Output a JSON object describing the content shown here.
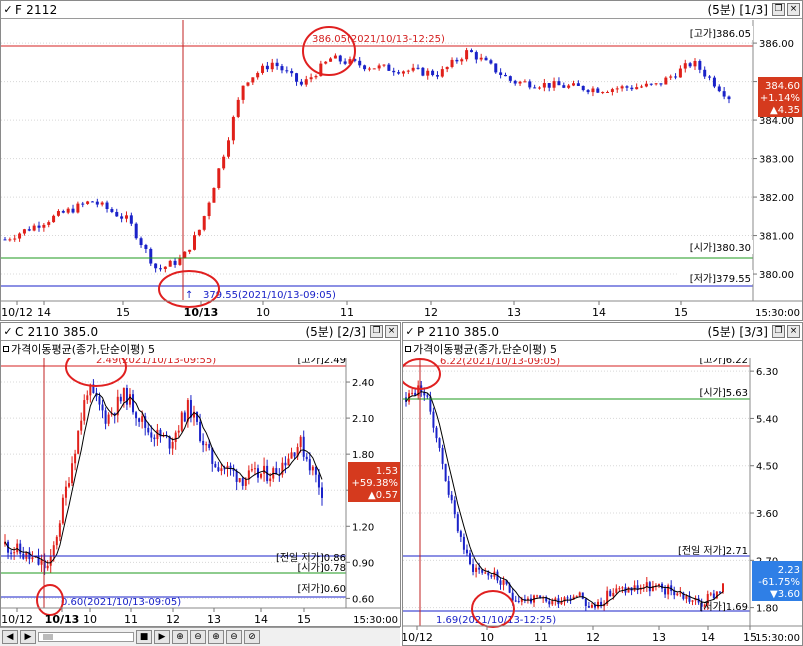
{
  "colors": {
    "up": "#e0201a",
    "down": "#1a22c8",
    "high_line": "#d42020",
    "open_line": "#1e9a1e",
    "low_line": "#1a22c8",
    "ma": "#000000",
    "circle": "#e02020"
  },
  "icons": {
    "check": "✓",
    "maximize": "□",
    "restore": "❐",
    "close": "×"
  },
  "scroll_icons": [
    "◀",
    "▶",
    "■",
    "▶",
    "⊕",
    "⊖",
    "⊕",
    "⊖",
    "⊘"
  ],
  "top": {
    "title": "F 2112",
    "period": "(5분)",
    "page": "[1/3]",
    "high_label": "[고가]386.05",
    "open_label": "[시가]380.30",
    "low_label": "[저가]379.55",
    "high_annotation": "386.05(2021/10/13-12:25)",
    "low_annotation": "379.55(2021/10/13-09:05)",
    "price_box": [
      "384.60",
      "+1.14%",
      "▲4.35"
    ],
    "bottom_right": "15:30:00"
  },
  "call": {
    "title": "C 2110 385.0",
    "period": "(5분)",
    "page": "[2/3]",
    "ma_label": "가격이동평균(종가,단순이평) 5",
    "high_label": "[고가]2.49",
    "prev_low_label": "[전일 저가]0.86",
    "open_label": "[시가]0.78",
    "low_label": "[저가]0.60",
    "high_annotation": "2.49(2021/10/13-09:55)",
    "low_annotation": "0.60(2021/10/13-09:05)",
    "price_box": [
      "1.53",
      "+59.38%",
      "▲0.57"
    ],
    "bottom_right": "15:30:00"
  },
  "put": {
    "title": "P 2110 385.0",
    "period": "(5분)",
    "page": "[3/3]",
    "ma_label": "가격이동평균(종가,단순이평) 5",
    "high_label": "[고가]6.22",
    "open_label": "[시가]5.63",
    "prev_low_label": "[전일 저가]2.71",
    "low_label": "[저가]1.69",
    "high_annotation": "6.22(2021/10/13-09:05)",
    "low_annotation": "1.69(2021/10/13-12:25)",
    "price_box": [
      "2.23",
      "-61.75%",
      "▼3.60"
    ],
    "bottom_right": "15:30:00"
  },
  "chart_data": [
    {
      "type": "candlestick",
      "name": "F 2112",
      "yticks": [
        "380.00",
        "381.00",
        "382.00",
        "383.00",
        "384.00",
        "385.00",
        "386.00"
      ],
      "ylim": [
        379.3,
        386.6
      ],
      "xticks": [
        "10/12",
        "14",
        "15",
        "10/13",
        "10",
        "11",
        "12",
        "13",
        "14",
        "15"
      ],
      "levels": {
        "high": 386.05,
        "open": 380.3,
        "low": 379.55,
        "last": 384.6
      }
    },
    {
      "type": "candlestick",
      "name": "C 2110 385.0",
      "yticks": [
        "0.60",
        "0.90",
        "1.20",
        "1.50",
        "1.80",
        "2.10",
        "2.40"
      ],
      "ylim": [
        0.52,
        2.6
      ],
      "xticks": [
        "10/12",
        "10/13",
        "10",
        "11",
        "12",
        "13",
        "14",
        "15"
      ],
      "levels": {
        "high": 2.49,
        "prev_low": 0.86,
        "open": 0.78,
        "low": 0.6,
        "last": 1.53
      }
    },
    {
      "type": "candlestick",
      "name": "P 2110 385.0",
      "yticks": [
        "1.80",
        "2.70",
        "3.60",
        "4.50",
        "5.40",
        "6.30"
      ],
      "ylim": [
        1.45,
        6.55
      ],
      "xticks": [
        "10/12",
        "10",
        "11",
        "12",
        "13",
        "14",
        "15"
      ],
      "levels": {
        "high": 6.22,
        "open": 5.63,
        "prev_low": 2.71,
        "low": 1.69,
        "last": 2.23
      }
    }
  ]
}
